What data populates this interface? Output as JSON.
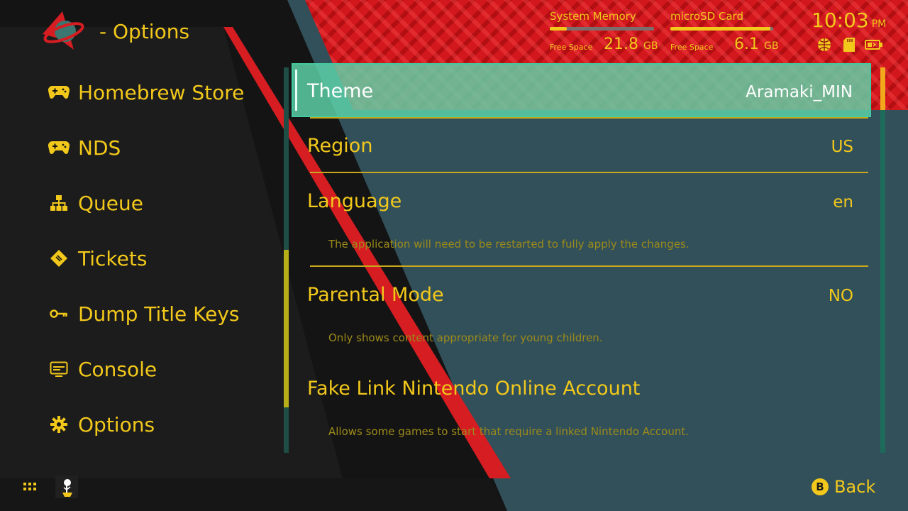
{
  "header": {
    "title": "- Options"
  },
  "sidebar": {
    "items": [
      {
        "label": "Homebrew Store",
        "icon": "gamepad-icon"
      },
      {
        "label": "NDS",
        "icon": "gamepad-icon"
      },
      {
        "label": "Queue",
        "icon": "hierarchy-icon"
      },
      {
        "label": "Tickets",
        "icon": "ticket-icon"
      },
      {
        "label": "Dump Title Keys",
        "icon": "key-icon"
      },
      {
        "label": "Console",
        "icon": "console-icon"
      },
      {
        "label": "Options",
        "icon": "gear-icon"
      }
    ]
  },
  "status": {
    "system_memory": {
      "label": "System Memory",
      "free_label": "Free Space",
      "value": "21.8",
      "unit": "GB",
      "used_fraction": 0.16
    },
    "sd_card": {
      "label": "microSD Card",
      "free_label": "Free Space",
      "value": "6.1",
      "unit": "GB",
      "used_fraction": 0.97
    },
    "time": "10:03",
    "ampm": "PM",
    "icons": [
      "globe-icon",
      "sd-card-icon",
      "battery-icon"
    ]
  },
  "options": [
    {
      "label": "Theme",
      "value": "Aramaki_MIN",
      "description": ""
    },
    {
      "label": "Region",
      "value": "US",
      "description": ""
    },
    {
      "label": "Language",
      "value": "en",
      "description": "The application will need to be restarted to fully apply the changes."
    },
    {
      "label": "Parental Mode",
      "value": "NO",
      "description": "Only shows content appropriate for young children."
    },
    {
      "label": "Fake Link Nintendo Online Account",
      "value": "",
      "description": "Allows some games to start that require a linked Nintendo Account."
    }
  ],
  "footer": {
    "back_button": "B",
    "back_label": "Back"
  },
  "colors": {
    "accent": "#f2c81b",
    "selection": "#5ed5ab",
    "panel": "#31505a",
    "red": "#d51d22"
  }
}
